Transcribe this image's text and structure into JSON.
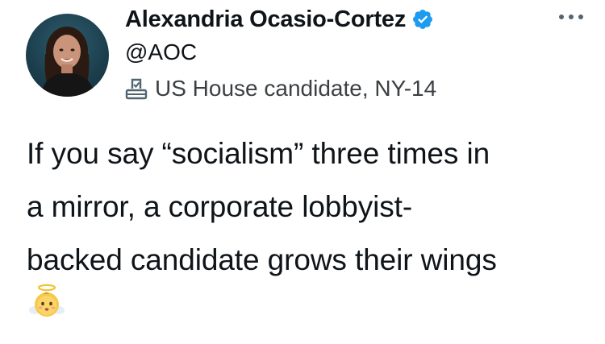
{
  "author": {
    "display_name": "Alexandria Ocasio-Cortez",
    "handle": "@AOC",
    "label": "US House candidate, NY-14",
    "verified": true
  },
  "tweet": {
    "lines": [
      "If you say “socialism” three times in",
      "a mirror, a corporate lobbyist-",
      "backed candidate grows their wings"
    ],
    "emoji": "angel-baby-emoji"
  },
  "colors": {
    "text": "#0f1419",
    "verified_blue": "#1d9bf0",
    "label_grey": "#3c4043"
  },
  "icons": {
    "verified": "verified-badge-icon",
    "more": "more-options-icon",
    "label": "ballot-box-icon"
  }
}
